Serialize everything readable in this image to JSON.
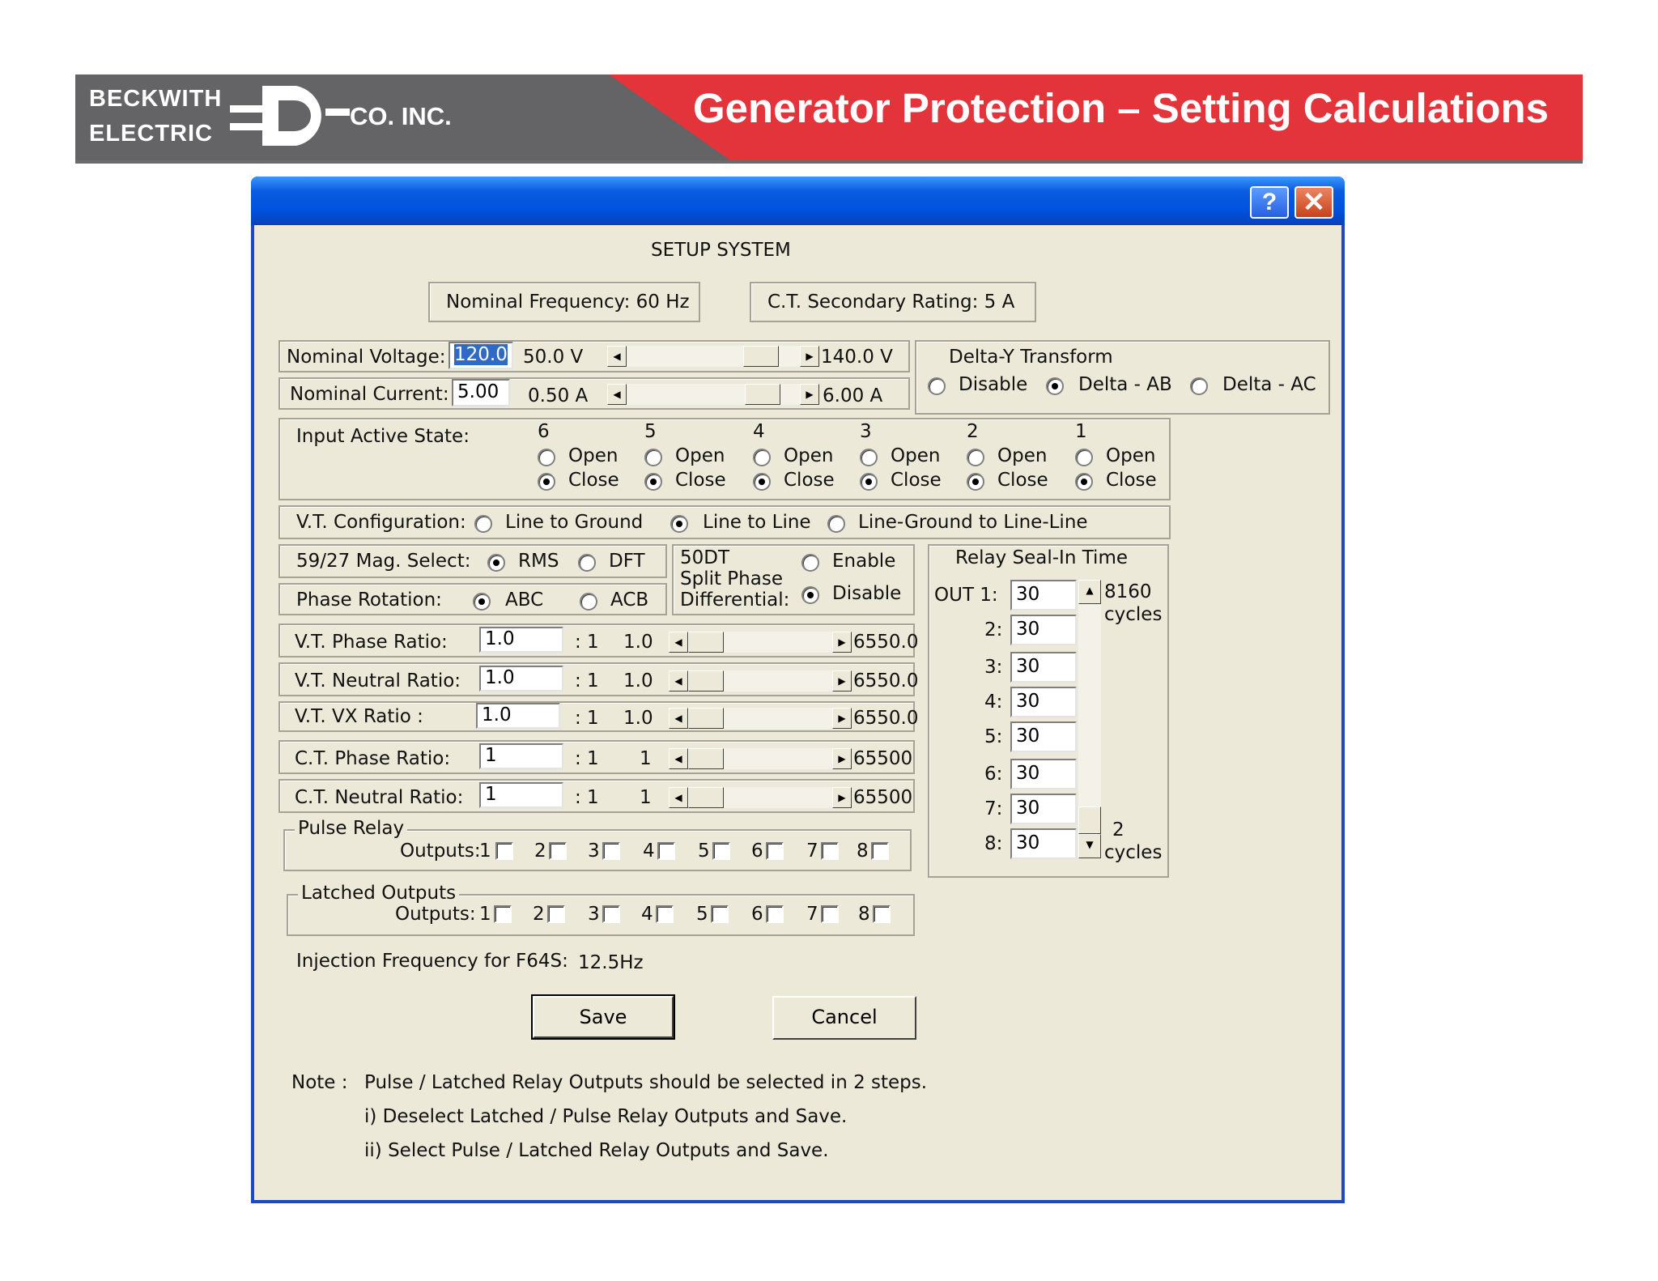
{
  "banner": {
    "logo_line1": "BECKWITH",
    "logo_line2": "ELECTRIC",
    "logo_suffix": "CO. INC.",
    "slide_title": "Generator Protection – Setting Calculations",
    "colors": {
      "gray": "#646467",
      "red": "#e3333b"
    }
  },
  "window": {
    "help_glyph": "?",
    "close_glyph": "✕",
    "heading": "SETUP   SYSTEM",
    "nominal_frequency": "Nominal Frequency:  60 Hz",
    "ct_secondary": "C.T. Secondary Rating:  5 A"
  },
  "nominal_voltage": {
    "label": "Nominal Voltage:",
    "value": "120.0",
    "min": "50.0  V",
    "max": "140.0  V"
  },
  "nominal_current": {
    "label": "Nominal Current:",
    "value": "5.00",
    "min": "0.50 A",
    "max": "6.00 A"
  },
  "delta_y": {
    "title": "Delta-Y Transform",
    "options": [
      "Disable",
      "Delta - AB",
      "Delta - AC"
    ],
    "selected": "Delta - AB"
  },
  "input_active_state": {
    "label": "Input Active State:",
    "open_label": "Open",
    "close_label": "Close",
    "inputs": [
      {
        "number": "6",
        "state": "Close"
      },
      {
        "number": "5",
        "state": "Close"
      },
      {
        "number": "4",
        "state": "Close"
      },
      {
        "number": "3",
        "state": "Close"
      },
      {
        "number": "2",
        "state": "Close"
      },
      {
        "number": "1",
        "state": "Close"
      }
    ]
  },
  "vt_configuration": {
    "label": "V.T. Configuration:",
    "options": [
      "Line to Ground",
      "Line to Line",
      "Line-Ground to Line-Line"
    ],
    "selected": "Line to Line"
  },
  "mag_select": {
    "label": "59/27 Mag. Select:",
    "options": [
      "RMS",
      "DFT"
    ],
    "selected": "RMS"
  },
  "phase_rotation": {
    "label": "Phase Rotation:",
    "options": [
      "ABC",
      "ACB"
    ],
    "selected": "ABC"
  },
  "split_phase": {
    "line1": "50DT",
    "line2": "Split Phase",
    "line3": "Differential:",
    "options": [
      "Enable",
      "Disable"
    ],
    "selected": "Disable"
  },
  "ratios": [
    {
      "label": "V.T. Phase Ratio:",
      "value": "1.0",
      "sep": ": 1",
      "min": "1.0",
      "max": "6550.0"
    },
    {
      "label": "V.T. Neutral Ratio:",
      "value": "1.0",
      "sep": ": 1",
      "min": "1.0",
      "max": "6550.0"
    },
    {
      "label": "V.T. VX Ratio :",
      "value": "1.0",
      "sep": ": 1",
      "min": "1.0",
      "max": "6550.0"
    },
    {
      "label": "C.T. Phase Ratio:",
      "value": "1",
      "sep": ": 1",
      "min": "1",
      "max": "65500"
    },
    {
      "label": "C.T. Neutral Ratio:",
      "value": "1",
      "sep": ": 1",
      "min": "1",
      "max": "65500"
    }
  ],
  "seal_in": {
    "title": "Relay Seal-In Time",
    "out1_label": "OUT 1:",
    "max_label": "8160",
    "max_unit": "cycles",
    "min_label": "2",
    "min_unit": "cycles",
    "outputs": [
      {
        "label": "OUT 1:",
        "value": "30"
      },
      {
        "label": "2:",
        "value": "30"
      },
      {
        "label": "3:",
        "value": "30"
      },
      {
        "label": "4:",
        "value": "30"
      },
      {
        "label": "5:",
        "value": "30"
      },
      {
        "label": "6:",
        "value": "30"
      },
      {
        "label": "7:",
        "value": "30"
      },
      {
        "label": "8:",
        "value": "30"
      }
    ]
  },
  "pulse_relay": {
    "title": "Pulse Relay",
    "outputs_label": "Outputs:",
    "items": [
      {
        "label": "1",
        "checked": false
      },
      {
        "label": "2",
        "checked": false
      },
      {
        "label": "3",
        "checked": false
      },
      {
        "label": "4",
        "checked": false
      },
      {
        "label": "5",
        "checked": false
      },
      {
        "label": "6",
        "checked": false
      },
      {
        "label": "7",
        "checked": false
      },
      {
        "label": "8",
        "checked": false
      }
    ]
  },
  "latched_outputs": {
    "title": "Latched Outputs",
    "outputs_label": "Outputs:",
    "items": [
      {
        "label": "1",
        "checked": false
      },
      {
        "label": "2",
        "checked": false
      },
      {
        "label": "3",
        "checked": false
      },
      {
        "label": "4",
        "checked": false
      },
      {
        "label": "5",
        "checked": false
      },
      {
        "label": "6",
        "checked": false
      },
      {
        "label": "7",
        "checked": false
      },
      {
        "label": "8",
        "checked": false
      }
    ]
  },
  "injection": {
    "label": "Injection Frequency for F64S:",
    "value": "12.5Hz"
  },
  "buttons": {
    "save": "Save",
    "cancel": "Cancel"
  },
  "note": {
    "label": "Note :",
    "line1": "Pulse / Latched  Relay Outputs should be selected in 2 steps.",
    "line2": "i) Deselect  Latched / Pulse  Relay  Outputs  and  Save.",
    "line3": "ii) Select Pulse / Latched Relay Outputs  and Save."
  }
}
